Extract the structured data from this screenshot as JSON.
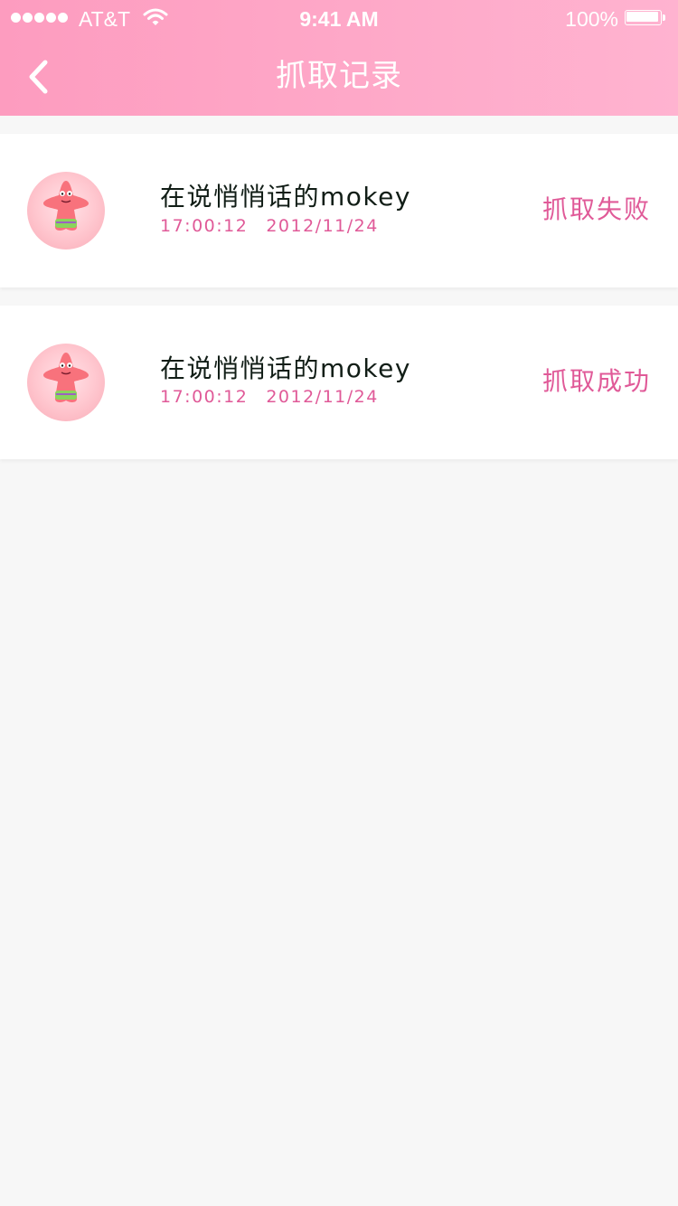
{
  "status_bar": {
    "carrier": "AT&T",
    "time": "9:41 AM",
    "battery_percent": "100%",
    "battery_level": 1.0
  },
  "nav": {
    "title": "抓取记录",
    "back_icon": "chevron-left-icon"
  },
  "colors": {
    "header_gradient_start": "#fd9cbf",
    "header_gradient_end": "#ffb3d0",
    "accent": "#e05a98",
    "name_text": "#111d16",
    "background": "#f7f7f7"
  },
  "records": [
    {
      "name": "在说悄悄话的mokey",
      "time": "17:00:12",
      "date": "2012/11/24",
      "status": "抓取失败",
      "avatar": "patrick-star-avatar"
    },
    {
      "name": "在说悄悄话的mokey",
      "time": "17:00:12",
      "date": "2012/11/24",
      "status": "抓取成功",
      "avatar": "patrick-star-avatar"
    }
  ]
}
